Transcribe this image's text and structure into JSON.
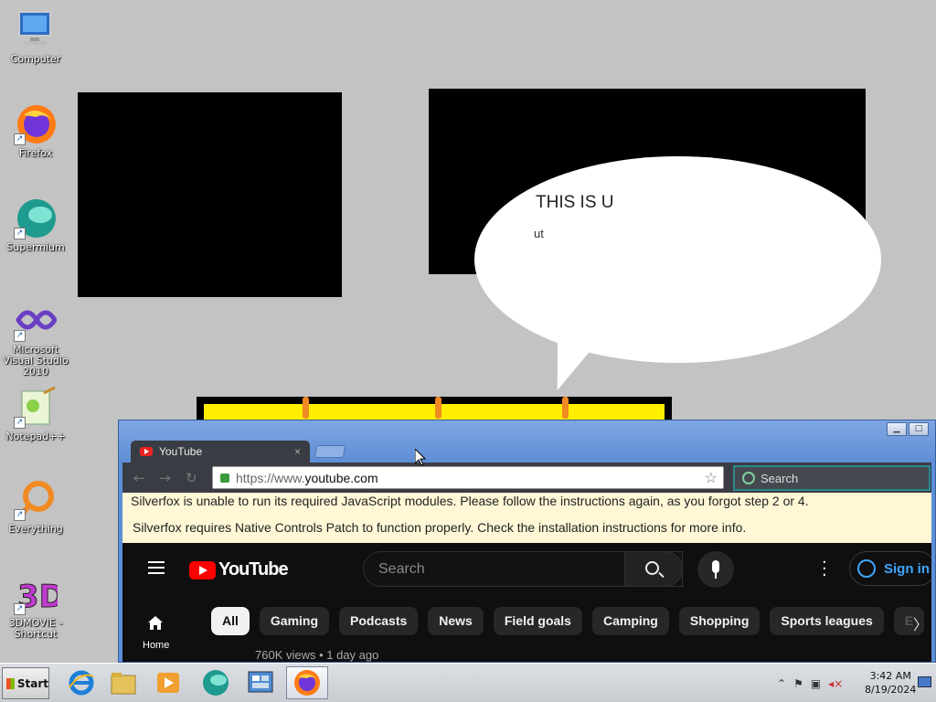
{
  "desktop": {
    "icons": [
      {
        "label": "Computer"
      },
      {
        "label": "Firefox"
      },
      {
        "label": "Supermium"
      },
      {
        "label": "Microsoft Visual Studio 2010"
      },
      {
        "label": "Notepad++"
      },
      {
        "label": "Everything"
      },
      {
        "label": "3DMOVIE - Shortcut"
      }
    ],
    "bubble_text": "THIS IS U",
    "bubble_subtext": "ut"
  },
  "browser": {
    "tab_title": "YouTube",
    "tab_close": "×",
    "url_prefix": "https://www.",
    "url_domain": "youtube.com",
    "search_placeholder": "Search",
    "notices": [
      "Silverfox is unable to run its required JavaScript modules. Please follow the instructions again, as you forgot step 2 or 4.",
      "Silverfox requires Native Controls Patch to function properly. Check the installation instructions for more info."
    ]
  },
  "youtube": {
    "logo_text": "YouTube",
    "search_placeholder": "Search",
    "signin_label": "Sign in",
    "home_label": "Home",
    "chips": [
      "All",
      "Gaming",
      "Podcasts",
      "News",
      "Field goals",
      "Camping",
      "Shopping",
      "Sports leagues",
      "E"
    ],
    "video_meta": "760K views • 1 day ago"
  },
  "taskbar": {
    "start_label": "Start",
    "time": "3:42 AM",
    "date": "8/19/2024"
  }
}
